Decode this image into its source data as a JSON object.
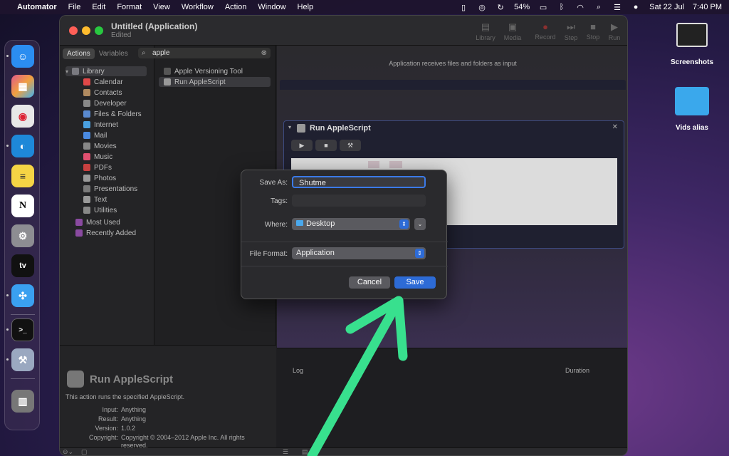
{
  "menubar": {
    "app": "Automator",
    "items": [
      "File",
      "Edit",
      "Format",
      "View",
      "Workflow",
      "Action",
      "Window",
      "Help"
    ],
    "battery": "54%",
    "date": "Sat 22 Jul",
    "time": "7:40 PM"
  },
  "desktop": {
    "icons": [
      {
        "label": "Screenshots"
      },
      {
        "label": "Vids alias"
      }
    ]
  },
  "dock": {
    "apps": [
      {
        "name": "Finder",
        "icon": "finder-icon",
        "color": "#2b8df0"
      },
      {
        "name": "Launchpad",
        "icon": "launchpad-icon",
        "color": "#e05a8a"
      },
      {
        "name": "Chrome",
        "icon": "chrome-icon",
        "color": "#e0e0e0"
      },
      {
        "name": "Edge",
        "icon": "edge-icon",
        "color": "#1e88d8"
      },
      {
        "name": "Notes",
        "icon": "notes-icon",
        "color": "#f5d445"
      },
      {
        "name": "Notion",
        "icon": "notion-icon",
        "color": "#ffffff",
        "glyph": "N"
      },
      {
        "name": "System Settings",
        "icon": "settings-icon",
        "color": "#8d8d92"
      },
      {
        "name": "Apple TV",
        "icon": "appletv-icon",
        "color": "#111111",
        "glyph": "tv"
      },
      {
        "name": "Safari",
        "icon": "safari-icon",
        "color": "#3aa0f0"
      },
      {
        "name": "Terminal",
        "icon": "terminal-icon",
        "color": "#111111",
        "glyph": ">_"
      },
      {
        "name": "Automator",
        "icon": "automator-icon",
        "color": "#9aa8c0"
      },
      {
        "name": "Trash",
        "icon": "trash-icon",
        "color": "#777777"
      }
    ]
  },
  "window": {
    "title": "Untitled (Application)",
    "subtitle": "Edited",
    "toolbar": [
      "Library",
      "Media",
      "Record",
      "Step",
      "Stop",
      "Run"
    ],
    "tabs": [
      "Actions",
      "Variables"
    ],
    "search": "apple",
    "library_root": "Library",
    "library": [
      "Calendar",
      "Contacts",
      "Developer",
      "Files & Folders",
      "Internet",
      "Mail",
      "Movies",
      "Music",
      "PDFs",
      "Photos",
      "Presentations",
      "Text",
      "Utilities"
    ],
    "library_extra": [
      "Most Used",
      "Recently Added"
    ],
    "actions": [
      "Apple Versioning Tool",
      "Run AppleScript"
    ],
    "workflow_hint": "Application receives files and folders as input",
    "action_card_title": "Run AppleScript",
    "log_label": "Log",
    "duration_label": "Duration",
    "desc": {
      "title": "Run AppleScript",
      "summary": "This action runs the specified AppleScript.",
      "input_label": "Input:",
      "input": "Anything",
      "result_label": "Result:",
      "result": "Anything",
      "version_label": "Version:",
      "version": "1.0.2",
      "copyright_label": "Copyright:",
      "copyright": "Copyright © 2004–2012 Apple Inc. All rights reserved."
    }
  },
  "save_dialog": {
    "save_as_label": "Save As:",
    "save_as_value": "Shutme",
    "tags_label": "Tags:",
    "where_label": "Where:",
    "where_value": "Desktop",
    "format_label": "File Format:",
    "format_value": "Application",
    "cancel": "Cancel",
    "save": "Save"
  },
  "colors": {
    "accent": "#2d6bd6",
    "arrow": "#38e08e"
  }
}
